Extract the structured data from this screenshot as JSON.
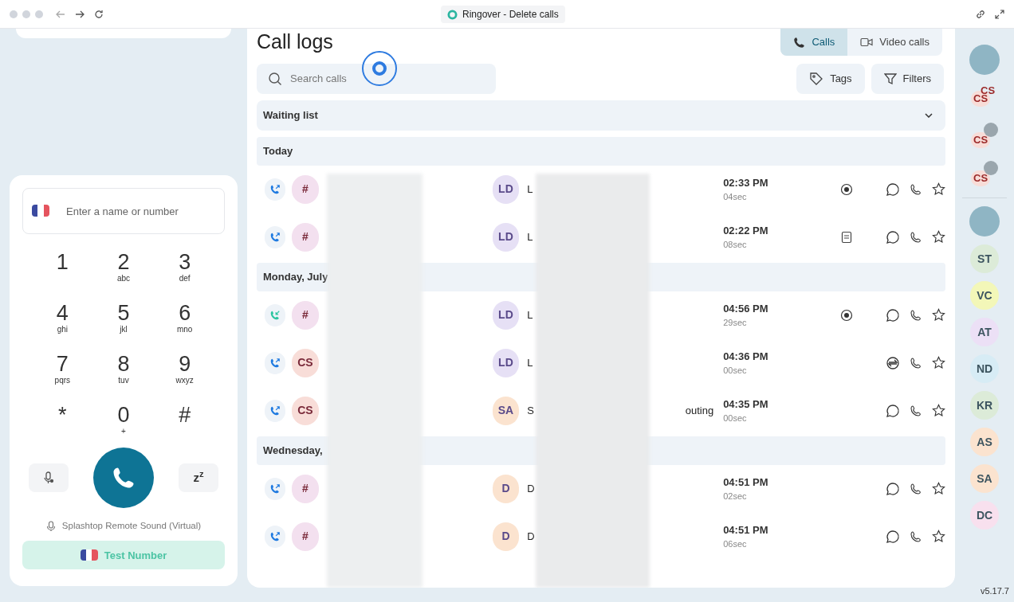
{
  "window": {
    "title": "Ringover - Delete calls"
  },
  "dialer": {
    "placeholder": "Enter a name or number",
    "keys": [
      {
        "digit": "1"
      },
      {
        "digit": "2",
        "letters": "abc"
      },
      {
        "digit": "3",
        "letters": "def"
      },
      {
        "digit": "4",
        "letters": "ghi"
      },
      {
        "digit": "5",
        "letters": "jkl"
      },
      {
        "digit": "6",
        "letters": "mno"
      },
      {
        "digit": "7",
        "letters": "pqrs"
      },
      {
        "digit": "8",
        "letters": "tuv"
      },
      {
        "digit": "9",
        "letters": "wxyz"
      },
      {
        "digit": "*"
      },
      {
        "digit": "0",
        "letters": "+"
      },
      {
        "digit": "#"
      }
    ],
    "snooze_label": "z",
    "snooze_sup": "z",
    "audio_device": "Splashtop Remote Sound (Virtual)",
    "test_number": "Test Number"
  },
  "main": {
    "title": "Call logs",
    "tabs": [
      {
        "label": "Calls",
        "kind": "phone",
        "selected": true
      },
      {
        "label": "Video calls",
        "kind": "video",
        "selected": false
      }
    ],
    "search": {
      "placeholder": "Search calls"
    },
    "buttons": [
      {
        "label": "Tags",
        "kind": "tag"
      },
      {
        "label": "Filters",
        "kind": "filter"
      }
    ],
    "waiting_list": {
      "label": "Waiting list",
      "expanded": false
    },
    "sections": [
      {
        "label": "Today",
        "rows": [
          {
            "direction": {
              "kind": "outgoing"
            },
            "caller": {
              "initials": "#",
              "color": "#f3e0ef"
            },
            "contact": {
              "initials": "LD",
              "color": "#e6e0f5"
            },
            "name": "L",
            "time": "02:33 PM",
            "duration": "04sec",
            "status": {
              "kind": "recording"
            },
            "action": {
              "kind": "chat"
            }
          },
          {
            "direction": {
              "kind": "outgoing"
            },
            "caller": {
              "initials": "#",
              "color": "#f3e0ef"
            },
            "contact": {
              "initials": "LD",
              "color": "#e6e0f5"
            },
            "name": "L",
            "time": "02:22 PM",
            "duration": "08sec",
            "status": {
              "kind": "note"
            },
            "action": {
              "kind": "chat"
            }
          }
        ]
      },
      {
        "label": "Monday, July",
        "rows": [
          {
            "direction": {
              "kind": "incoming"
            },
            "caller": {
              "initials": "#",
              "color": "#f3e0ef"
            },
            "contact": {
              "initials": "LD",
              "color": "#e6e0f5"
            },
            "name": "L",
            "time": "04:56 PM",
            "duration": "29sec",
            "status": {
              "kind": "recording"
            },
            "action": {
              "kind": "chat"
            }
          },
          {
            "direction": {
              "kind": "outgoing"
            },
            "caller": {
              "initials": "CS",
              "color": "#f8ddd8"
            },
            "contact": {
              "initials": "LD",
              "color": "#e6e0f5"
            },
            "name": "L",
            "time": "04:36 PM",
            "duration": "00sec",
            "action": {
              "kind": "transfer"
            }
          },
          {
            "direction": {
              "kind": "outgoing"
            },
            "caller": {
              "initials": "CS",
              "color": "#f8ddd8"
            },
            "contact": {
              "initials": "SA",
              "color": "#fbe3cf"
            },
            "name": "S",
            "name_tail": "outing",
            "time": "04:35 PM",
            "duration": "00sec",
            "action": {
              "kind": "chat"
            }
          }
        ]
      },
      {
        "label": "Wednesday,",
        "rows": [
          {
            "direction": {
              "kind": "outgoing"
            },
            "caller": {
              "initials": "#",
              "color": "#f3e0ef"
            },
            "contact": {
              "initials": "D",
              "color": "#fbe3cf"
            },
            "name": "D",
            "time": "04:51 PM",
            "duration": "02sec",
            "action": {
              "kind": "chat"
            }
          },
          {
            "direction": {
              "kind": "outgoing"
            },
            "caller": {
              "initials": "#",
              "color": "#f3e0ef"
            },
            "contact": {
              "initials": "D",
              "color": "#fbe3cf"
            },
            "name": "D",
            "time": "04:51 PM",
            "duration": "06sec",
            "action": {
              "kind": "chat"
            }
          }
        ]
      }
    ]
  },
  "rail": {
    "items": [
      {
        "kind": "photo"
      },
      {
        "kind": "group",
        "initials": "CS",
        "second": "CS"
      },
      {
        "kind": "group_photo",
        "initials": "CS"
      },
      {
        "kind": "group_photo",
        "initials": "CS"
      },
      {
        "kind": "divider"
      },
      {
        "kind": "photo"
      },
      {
        "kind": "initials",
        "initials": "ST",
        "color": "#dcebd8"
      },
      {
        "kind": "initials",
        "initials": "VC",
        "color": "#f3f7b8"
      },
      {
        "kind": "initials",
        "initials": "AT",
        "color": "#ece0f6"
      },
      {
        "kind": "initials",
        "initials": "ND",
        "color": "#d7ecf5"
      },
      {
        "kind": "initials",
        "initials": "KR",
        "color": "#dcebd8"
      },
      {
        "kind": "initials",
        "initials": "AS",
        "color": "#fbe3cf"
      },
      {
        "kind": "initials",
        "initials": "SA",
        "color": "#fbe3cf"
      },
      {
        "kind": "initials",
        "initials": "DC",
        "color": "#f8e0ee"
      }
    ],
    "version": "v5.17.7"
  }
}
